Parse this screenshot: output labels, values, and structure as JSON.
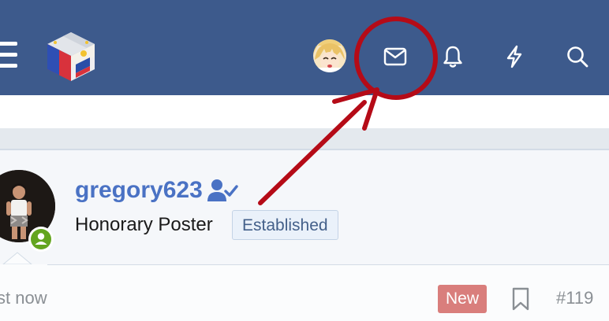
{
  "header": {
    "nav": [
      {
        "name": "user-avatar",
        "icon": "anime-avatar"
      },
      {
        "name": "inbox",
        "icon": "envelope-icon"
      },
      {
        "name": "alerts",
        "icon": "bell-icon"
      },
      {
        "name": "whats-new",
        "icon": "lightning-icon"
      },
      {
        "name": "search",
        "icon": "search-icon"
      }
    ],
    "colors": {
      "bar": "#3d5a8c",
      "icon": "#ffffff"
    }
  },
  "post": {
    "author": "gregory623",
    "user_title": "Honorary Poster",
    "banner": "Established",
    "time": "st now",
    "new_label": "New",
    "post_number": "#119",
    "online": true
  },
  "annotation": {
    "color": "#b50b17"
  }
}
